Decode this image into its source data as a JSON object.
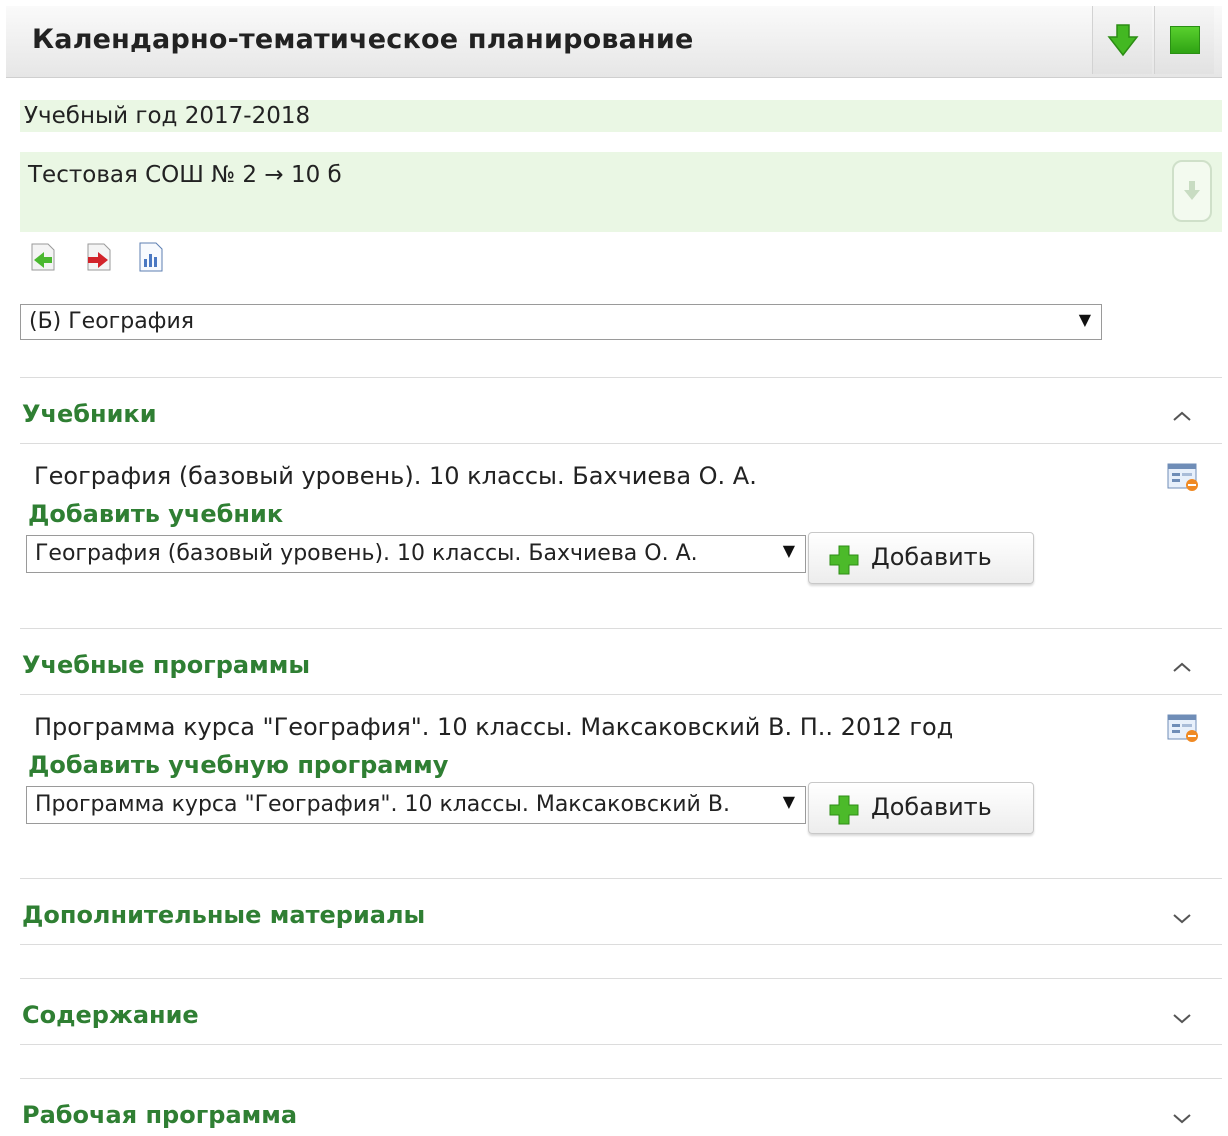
{
  "header": {
    "title": "Календарно-тематическое планирование",
    "colors": {
      "accent": "#2fa314",
      "arrow": "#3cb21f"
    }
  },
  "info": {
    "year": "Учебный год 2017-2018",
    "school": "Тестовая СОШ № 2 → 10 б"
  },
  "toolbar": {
    "icons": [
      "import-icon",
      "export-icon",
      "report-icon"
    ]
  },
  "subject_select": {
    "value": "(Б) География"
  },
  "sections": {
    "textbooks": {
      "title": "Учебники",
      "expanded": true,
      "item": "География (базовый уровень). 10 классы. Бахчиева О. А.",
      "add_link": "Добавить учебник",
      "select_value": "География (базовый уровень). 10 классы. Бахчиева О. А.",
      "add_button": "Добавить"
    },
    "programs": {
      "title": "Учебные программы",
      "expanded": true,
      "item": "Программа курса \"География\". 10 классы. Максаковский В. П.. 2012 год",
      "add_link": "Добавить учебную программу",
      "select_value": "Программа курса \"География\". 10 классы. Максаковский В.",
      "add_button": "Добавить"
    },
    "extra": {
      "title": "Дополнительные материалы",
      "expanded": false
    },
    "content": {
      "title": "Содержание",
      "expanded": false
    },
    "work_program": {
      "title": "Рабочая программа",
      "expanded": false
    }
  }
}
